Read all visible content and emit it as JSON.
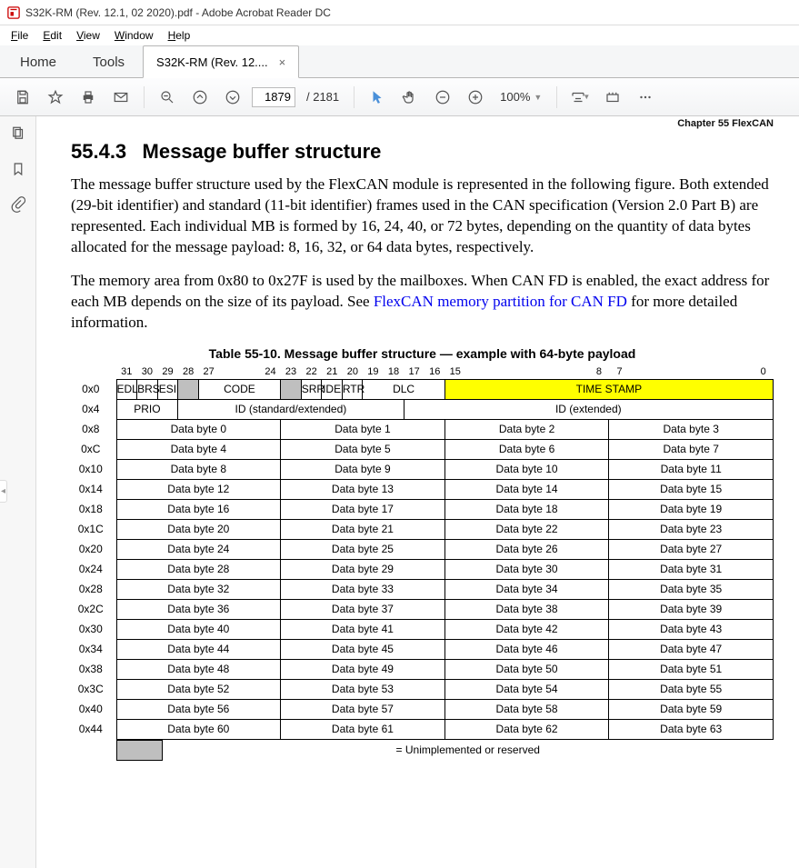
{
  "window": {
    "title": "S32K-RM (Rev. 12.1, 02 2020).pdf - Adobe Acrobat Reader DC"
  },
  "menu": {
    "file": "File",
    "edit": "Edit",
    "view": "View",
    "window": "Window",
    "help": "Help"
  },
  "tabs": {
    "home": "Home",
    "tools": "Tools",
    "doc": "S32K-RM (Rev. 12....",
    "close": "×"
  },
  "toolbar": {
    "page_current": "1879",
    "page_total": "/ 2181",
    "zoom": "100%"
  },
  "doc": {
    "chapter_header": "Chapter 55 FlexCAN",
    "section_num": "55.4.3",
    "section_title": "Message buffer structure",
    "para1": "The message buffer structure used by the FlexCAN module is represented in the following figure. Both extended (29-bit identifier) and standard (11-bit identifier) frames used in the CAN specification (Version 2.0 Part B) are represented. Each individual MB is formed by 16, 24, 40, or 72 bytes, depending on the quantity of data bytes allocated for the message payload: 8, 16, 32, or 64 data bytes, respectively.",
    "para2a": "The memory area from 0x80 to 0x27F is used by the mailboxes. When CAN FD is enabled, the exact address for each MB depends on the size of its payload. See ",
    "para2link": "FlexCAN memory partition for CAN FD",
    "para2b": " for more detailed information.",
    "table_caption": "Table 55-10.   Message buffer structure — example with 64-byte payload",
    "legend_text": "= Unimplemented or reserved"
  },
  "bits": [
    "31",
    "30",
    "29",
    "28",
    "27",
    "",
    "",
    "24",
    "23",
    "22",
    "21",
    "20",
    "19",
    "18",
    "17",
    "16",
    "15",
    "",
    "",
    "",
    "",
    "",
    "",
    "8",
    "7",
    "",
    "",
    "",
    "",
    "",
    "",
    "0"
  ],
  "row0": {
    "addr": "0x0",
    "edl": "EDL",
    "brs": "BRS",
    "esi": "ESI",
    "code": "CODE",
    "srr": "SRR",
    "ide": "IDE",
    "rtr": "RTR",
    "dlc": "DLC",
    "ts": "TIME STAMP"
  },
  "row4": {
    "addr": "0x4",
    "prio": "PRIO",
    "idstd": "ID (standard/extended)",
    "idext": "ID (extended)"
  },
  "data_rows": [
    {
      "addr": "0x8",
      "b0": "Data byte 0",
      "b1": "Data byte 1",
      "b2": "Data byte 2",
      "b3": "Data byte 3"
    },
    {
      "addr": "0xC",
      "b0": "Data byte 4",
      "b1": "Data byte 5",
      "b2": "Data byte 6",
      "b3": "Data byte 7"
    },
    {
      "addr": "0x10",
      "b0": "Data byte 8",
      "b1": "Data byte 9",
      "b2": "Data byte 10",
      "b3": "Data byte 11"
    },
    {
      "addr": "0x14",
      "b0": "Data byte 12",
      "b1": "Data byte 13",
      "b2": "Data byte 14",
      "b3": "Data byte 15"
    },
    {
      "addr": "0x18",
      "b0": "Data byte 16",
      "b1": "Data byte 17",
      "b2": "Data byte 18",
      "b3": "Data byte 19"
    },
    {
      "addr": "0x1C",
      "b0": "Data byte 20",
      "b1": "Data byte 21",
      "b2": "Data byte 22",
      "b3": "Data byte 23"
    },
    {
      "addr": "0x20",
      "b0": "Data byte 24",
      "b1": "Data byte 25",
      "b2": "Data byte 26",
      "b3": "Data byte 27"
    },
    {
      "addr": "0x24",
      "b0": "Data byte 28",
      "b1": "Data byte 29",
      "b2": "Data byte 30",
      "b3": "Data byte 31"
    },
    {
      "addr": "0x28",
      "b0": "Data byte 32",
      "b1": "Data byte 33",
      "b2": "Data byte 34",
      "b3": "Data byte 35"
    },
    {
      "addr": "0x2C",
      "b0": "Data byte 36",
      "b1": "Data byte 37",
      "b2": "Data byte 38",
      "b3": "Data byte 39"
    },
    {
      "addr": "0x30",
      "b0": "Data byte 40",
      "b1": "Data byte 41",
      "b2": "Data byte 42",
      "b3": "Data byte 43"
    },
    {
      "addr": "0x34",
      "b0": "Data byte 44",
      "b1": "Data byte 45",
      "b2": "Data byte 46",
      "b3": "Data byte 47"
    },
    {
      "addr": "0x38",
      "b0": "Data byte 48",
      "b1": "Data byte 49",
      "b2": "Data byte 50",
      "b3": "Data byte 51"
    },
    {
      "addr": "0x3C",
      "b0": "Data byte 52",
      "b1": "Data byte 53",
      "b2": "Data byte 54",
      "b3": "Data byte 55"
    },
    {
      "addr": "0x40",
      "b0": "Data byte 56",
      "b1": "Data byte 57",
      "b2": "Data byte 58",
      "b3": "Data byte 59"
    },
    {
      "addr": "0x44",
      "b0": "Data byte 60",
      "b1": "Data byte 61",
      "b2": "Data byte 62",
      "b3": "Data byte 63"
    }
  ]
}
